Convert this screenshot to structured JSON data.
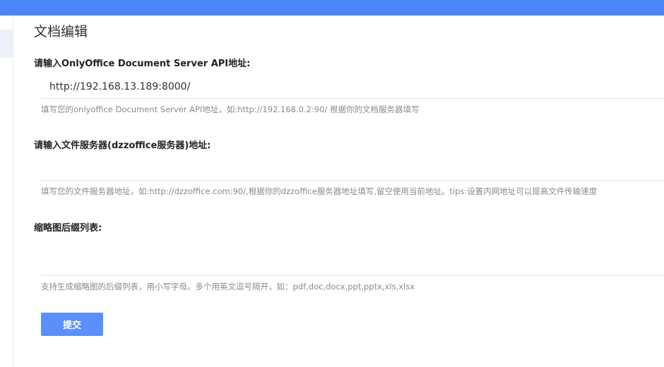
{
  "header": {
    "bar_color": "#4a86f7"
  },
  "page": {
    "title": "文档编辑"
  },
  "form": {
    "api_address": {
      "label": "请输入OnlyOffice Document Server API地址:",
      "value": "http://192.168.13.189:8000/",
      "hint": "填写您的onlyoffice Document Server API地址，如:http://192.168.0.2:90/ 根据你的文档服务器填写"
    },
    "file_server": {
      "label": "请输入文件服务器(dzzoffice服务器)地址:",
      "value": "",
      "hint": "填写您的文件服务器地址，如:http://dzzoffice.com:90/,根据你的dzzoffice服务器地址填写,留空使用当前地址。tips:设置内网地址可以提高文件传输速度"
    },
    "thumbnail_ext": {
      "label": "缩略图后缀列表:",
      "value": "",
      "hint": "支持生成缩略图的后缀列表，用小写字母。多个用英文逗号隔开，如：pdf,doc,docx,ppt,pptx,xls,xlsx"
    },
    "submit_label": "提交",
    "submit_color": "#5b8ff9"
  }
}
